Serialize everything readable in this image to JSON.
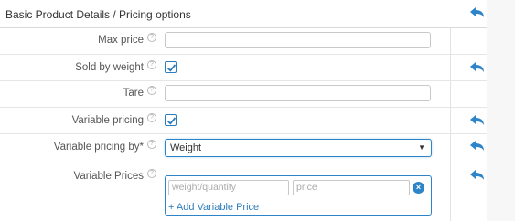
{
  "header": {
    "title": "Basic Product Details / Pricing options"
  },
  "fields": {
    "max_price": {
      "label": "Max price",
      "value": ""
    },
    "sold_by_weight": {
      "label": "Sold by weight",
      "checked": true
    },
    "tare": {
      "label": "Tare",
      "value": ""
    },
    "variable_pricing": {
      "label": "Variable pricing",
      "checked": true
    },
    "variable_pricing_by": {
      "label": "Variable pricing by*",
      "selected": "Weight"
    },
    "variable_prices": {
      "label": "Variable Prices",
      "weight_placeholder": "weight/quantity",
      "price_placeholder": "price",
      "add_label": "+ Add Variable Price"
    }
  },
  "help_symbol": "?",
  "remove_symbol": "×",
  "caret_symbol": "▼",
  "colors": {
    "accent": "#2d84c9",
    "border": "#c8c8c8"
  }
}
